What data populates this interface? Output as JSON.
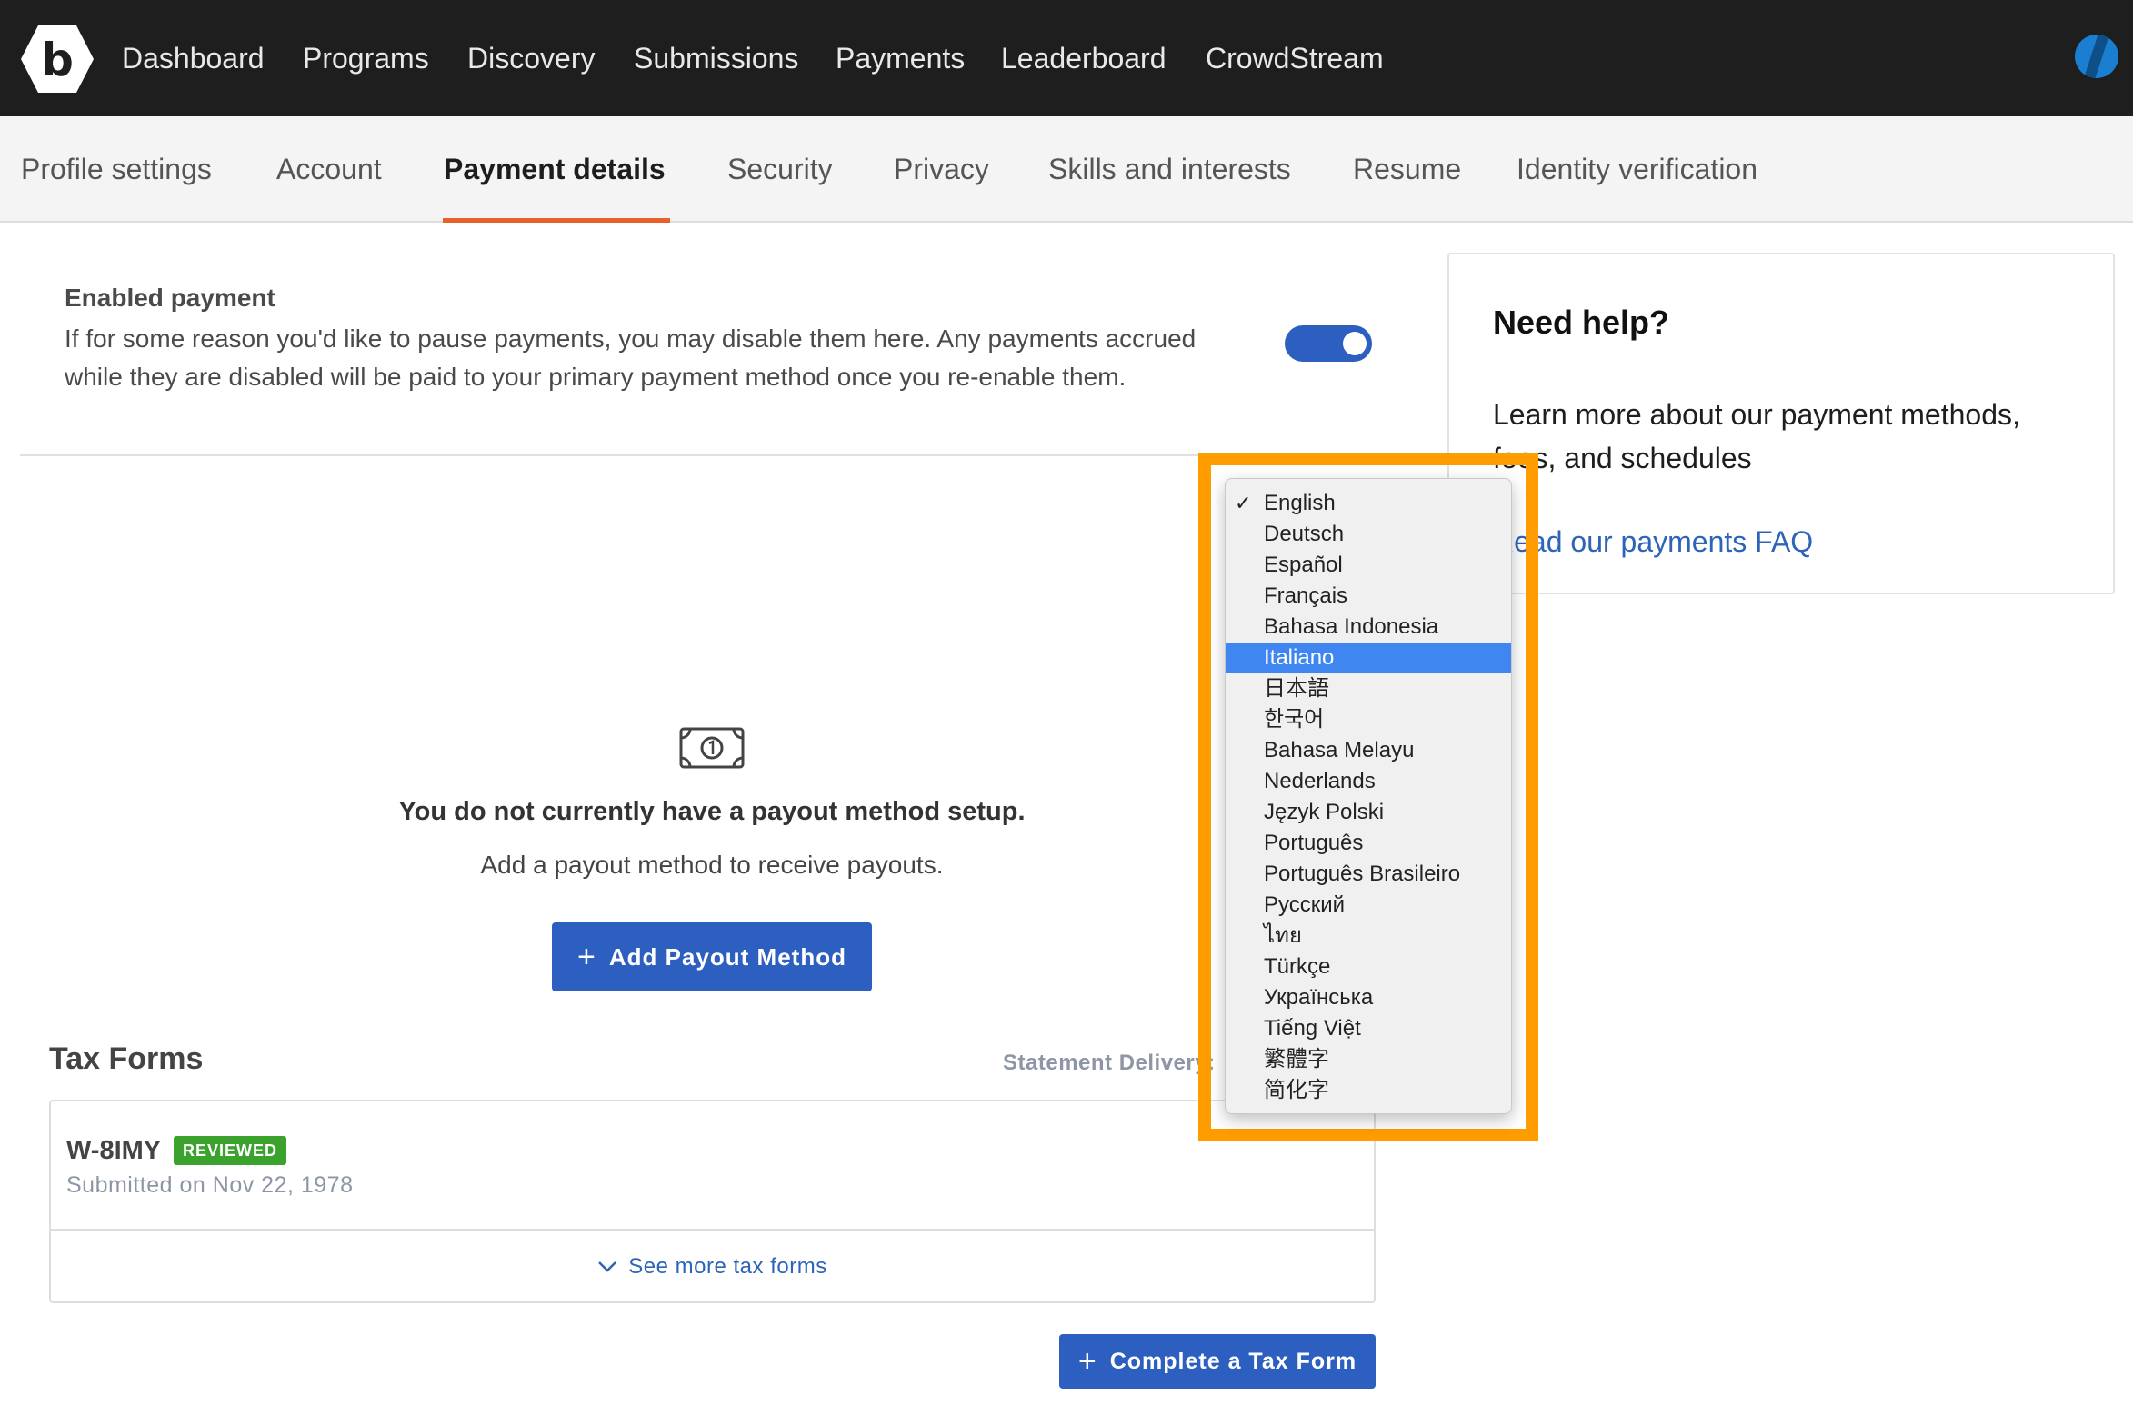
{
  "topnav": {
    "logo_letter": "b",
    "items": [
      "Dashboard",
      "Programs",
      "Discovery",
      "Submissions",
      "Payments",
      "Leaderboard",
      "CrowdStream"
    ]
  },
  "subnav": {
    "tabs": [
      "Profile settings",
      "Account",
      "Payment details",
      "Security",
      "Privacy",
      "Skills and interests",
      "Resume",
      "Identity verification"
    ],
    "active_tab": "Payment details"
  },
  "enabled_payment": {
    "title": "Enabled payment",
    "description": "If for some reason you'd like to pause payments, you may disable them here. Any payments accrued while they are disabled will be paid to your primary payment method once you re-enable them.",
    "enabled": true
  },
  "help": {
    "title": "Need help?",
    "text": "Learn more about our payment methods, fees, and schedules",
    "link": "Read our payments FAQ"
  },
  "payout": {
    "empty_title": "You do not currently have a payout method setup.",
    "empty_subtitle": "Add a payout method to receive payouts.",
    "add_button": "Add Payout Method"
  },
  "tax_forms": {
    "title": "Tax Forms",
    "statement_label": "Statement Delivery:",
    "form": {
      "name": "W-8IMY",
      "status": "REVIEWED",
      "submitted": "Submitted on Nov 22, 1978"
    },
    "see_more": "See more tax forms",
    "complete_button": "Complete a Tax Form"
  },
  "language_dropdown": {
    "checked": "English",
    "highlighted": "Italiano",
    "options": [
      "English",
      "Deutsch",
      "Español",
      "Français",
      "Bahasa Indonesia",
      "Italiano",
      "日本語",
      "한국어",
      "Bahasa Melayu",
      "Nederlands",
      "Język Polski",
      "Português",
      "Português Brasileiro",
      "Русский",
      "ไทย",
      "Türkçe",
      "Українська",
      "Tiếng Việt",
      "繁體字",
      "简化字"
    ]
  },
  "colors": {
    "accent": "#2d5fc0",
    "tab_underline": "#e8612c",
    "highlight_border": "#ff9c00",
    "badge": "#3aa22d",
    "dropdown_selection": "#3f86f1"
  }
}
